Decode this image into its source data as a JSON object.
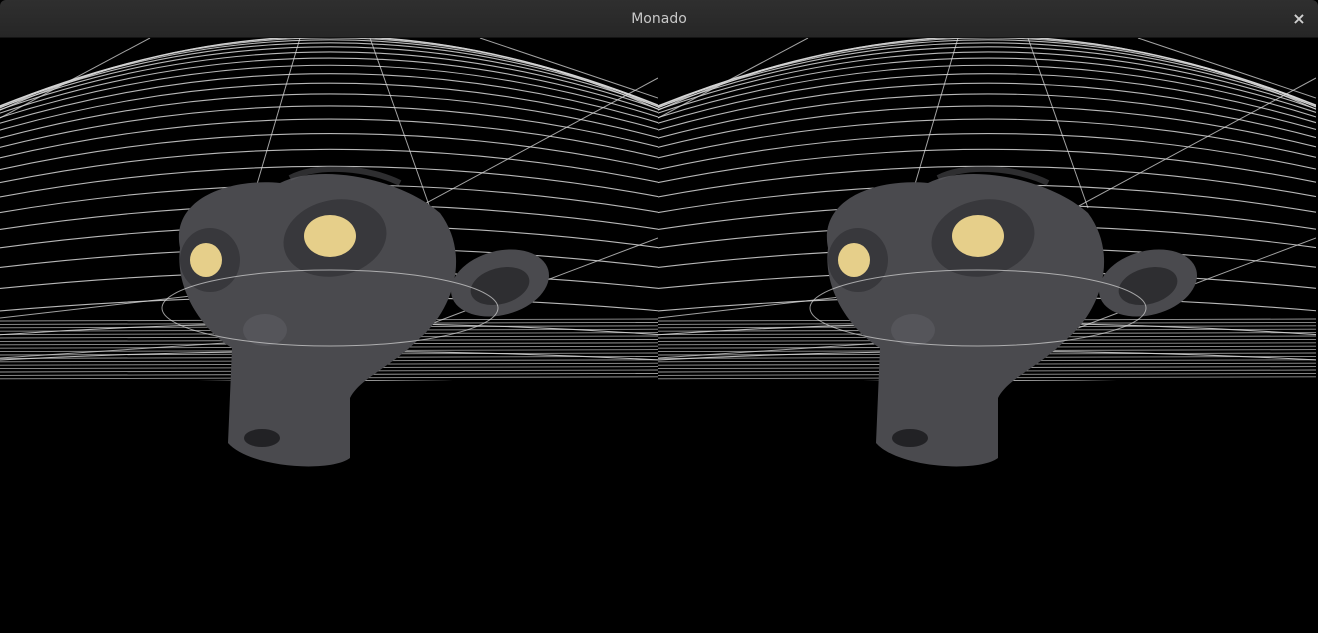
{
  "window": {
    "title": "Monado",
    "close_symbol": "×"
  },
  "viewport": {
    "views": [
      {
        "eye": "left"
      },
      {
        "eye": "right"
      }
    ]
  },
  "colors": {
    "titlebar": "#2a2a2a",
    "background": "#000000",
    "grid_lines": "#d8d8d8",
    "monkey_skin": "#4a4a4e",
    "monkey_eyes": "#e6cf8a"
  },
  "icons": {
    "close": "close-icon"
  }
}
